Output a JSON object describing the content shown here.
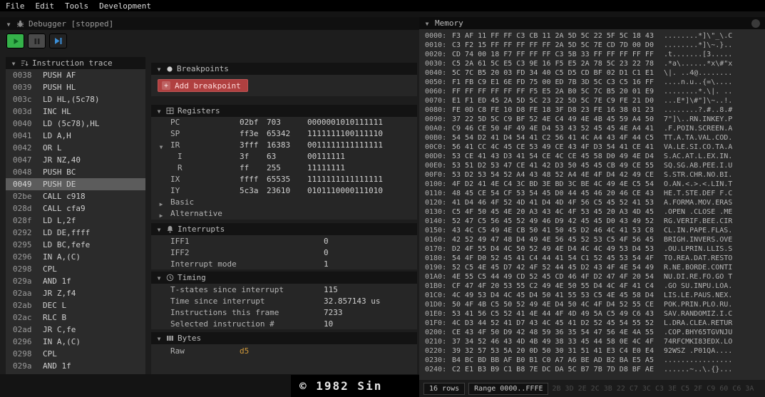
{
  "menu": {
    "items": [
      "File",
      "Edit",
      "Tools",
      "Development"
    ]
  },
  "colors": {
    "accent_red": "#b04040",
    "value_orange": "#d29a3a",
    "play_green": "#35b24a",
    "step_blue": "#3b8fd8",
    "selected_row": "#5c5c5c"
  },
  "debugger": {
    "title": "Debugger [stopped]",
    "toolbar_icons": [
      "play-icon",
      "pause-icon",
      "step-icon"
    ]
  },
  "trace": {
    "title": "Instruction trace",
    "selected_index": 9,
    "rows": [
      {
        "addr": "0038",
        "instr": "PUSH AF"
      },
      {
        "addr": "0039",
        "instr": "PUSH HL"
      },
      {
        "addr": "003c",
        "instr": "LD HL,(5c78)"
      },
      {
        "addr": "003d",
        "instr": "INC HL"
      },
      {
        "addr": "0040",
        "instr": "LD (5c78),HL"
      },
      {
        "addr": "0041",
        "instr": "LD A,H"
      },
      {
        "addr": "0042",
        "instr": "OR L"
      },
      {
        "addr": "0047",
        "instr": "JR NZ,40"
      },
      {
        "addr": "0048",
        "instr": "PUSH BC"
      },
      {
        "addr": "0049",
        "instr": "PUSH DE"
      },
      {
        "addr": "02be",
        "instr": "CALL c918"
      },
      {
        "addr": "028d",
        "instr": "CALL cfa9"
      },
      {
        "addr": "028f",
        "instr": "LD L,2f"
      },
      {
        "addr": "0292",
        "instr": "LD DE,ffff"
      },
      {
        "addr": "0295",
        "instr": "LD BC,fefe"
      },
      {
        "addr": "0296",
        "instr": "IN A,(C)"
      },
      {
        "addr": "0298",
        "instr": "CPL"
      },
      {
        "addr": "029a",
        "instr": "AND 1f"
      },
      {
        "addr": "02aa",
        "instr": "JR Z,f4"
      },
      {
        "addr": "02ab",
        "instr": "DEC L"
      },
      {
        "addr": "02ac",
        "instr": "RLC B"
      },
      {
        "addr": "02ad",
        "instr": "JR C,fe"
      },
      {
        "addr": "0296",
        "instr": "IN A,(C)"
      },
      {
        "addr": "0298",
        "instr": "CPL"
      },
      {
        "addr": "029a",
        "instr": "AND 1f"
      }
    ]
  },
  "breakpoints": {
    "title": "Breakpoints",
    "add_label": "Add breakpoint"
  },
  "registers": {
    "title": "Registers",
    "rows": [
      {
        "name": "PC",
        "hex": "02bf",
        "dec": "703",
        "bin": "0000001010111111",
        "indent": false,
        "expandable": false
      },
      {
        "name": "SP",
        "hex": "ff3e",
        "dec": "65342",
        "bin": "1111111100111110",
        "indent": false,
        "expandable": false
      },
      {
        "name": "IR",
        "hex": "3fff",
        "dec": "16383",
        "bin": "0011111111111111",
        "indent": false,
        "expandable": true
      },
      {
        "name": "I",
        "hex": "3f",
        "dec": "63",
        "bin": "00111111",
        "indent": true,
        "expandable": false
      },
      {
        "name": "R",
        "hex": "ff",
        "dec": "255",
        "bin": "11111111",
        "indent": true,
        "expandable": false
      },
      {
        "name": "IX",
        "hex": "ffff",
        "dec": "65535",
        "bin": "1111111111111111",
        "indent": false,
        "expandable": false
      },
      {
        "name": "IY",
        "hex": "5c3a",
        "dec": "23610",
        "bin": "0101110000111010",
        "indent": false,
        "expandable": false
      }
    ],
    "groups": [
      {
        "label": "Basic"
      },
      {
        "label": "Alternative"
      }
    ]
  },
  "interrupts": {
    "title": "Interrupts",
    "rows": [
      {
        "label": "IFF1",
        "value": "0"
      },
      {
        "label": "IFF2",
        "value": "0"
      },
      {
        "label": "Interrupt mode",
        "value": "1"
      }
    ]
  },
  "timing": {
    "title": "Timing",
    "rows": [
      {
        "label": "T-states since interrupt",
        "value": "115"
      },
      {
        "label": "Time since interrupt",
        "value": "32.857143 us"
      },
      {
        "label": "Instructions this frame",
        "value": "7233"
      },
      {
        "label": "Selected instruction #",
        "value": "10"
      }
    ]
  },
  "bytes": {
    "title": "Bytes",
    "rows": [
      {
        "label": "Raw",
        "value": "d5"
      }
    ]
  },
  "memory": {
    "title": "Memory",
    "footer": {
      "rows_label": "16 rows",
      "range_label": "Range 0000..FFFE",
      "ghost_hex": "2B 3D 2E 2C 3B 22 C7 3C C3 3E C5 2F C9 60 C6 3A"
    },
    "rows": [
      {
        "addr": "0000",
        "hex": "F3 AF 11 FF FF C3 CB 11 2A 5D 5C 22 5F 5C 18 43",
        "ascii": "........*]\\\"_\\.C"
      },
      {
        "addr": "0010",
        "hex": "C3 F2 15 FF FF FF FF FF 2A 5D 5C 7E CD 7D 00 D0",
        "ascii": "........*]\\~.}.."
      },
      {
        "addr": "0020",
        "hex": "CD 74 00 18 F7 FF FF FF C3 5B 33 FF FF FF FF FF",
        "ascii": ".t.......[3....."
      },
      {
        "addr": "0030",
        "hex": "C5 2A 61 5C E5 C3 9E 16 F5 E5 2A 78 5C 23 22 78",
        "ascii": ".*a\\......*x\\#\"x"
      },
      {
        "addr": "0040",
        "hex": "5C 7C B5 20 03 FD 34 40 C5 D5 CD BF 02 D1 C1 E1",
        "ascii": "\\|. ..4@........"
      },
      {
        "addr": "0050",
        "hex": "F1 FB C9 E1 6E FD 75 00 ED 7B 3D 5C C3 C5 16 FF",
        "ascii": "....n.u..{=\\...."
      },
      {
        "addr": "0060",
        "hex": "FF FF FF FF FF FF F5 E5 2A B0 5C 7C B5 20 01 E9",
        "ascii": "........*.\\|. .."
      },
      {
        "addr": "0070",
        "hex": "E1 F1 ED 45 2A 5D 5C 23 22 5D 5C 7E C9 FE 21 D0",
        "ascii": "...E*]\\#\"]\\~..!."
      },
      {
        "addr": "0080",
        "hex": "FE 0D C8 FE 10 D8 FE 18 3F D8 23 FE 16 38 01 23",
        "ascii": "........?.#..8.#"
      },
      {
        "addr": "0090",
        "hex": "37 22 5D 5C C9 BF 52 4E C4 49 4E 4B 45 59 A4 50",
        "ascii": "7\"]\\..RN.INKEY.P"
      },
      {
        "addr": "00A0",
        "hex": "C9 46 CE 50 4F 49 4E D4 53 43 52 45 45 4E A4 41",
        "ascii": ".F.POIN.SCREEN.A"
      },
      {
        "addr": "00B0",
        "hex": "54 54 D2 41 D4 54 41 C2 56 41 4C A4 43 4F 44 C5",
        "ascii": "TT.A.TA.VAL.COD."
      },
      {
        "addr": "00C0",
        "hex": "56 41 CC 4C 45 CE 53 49 CE 43 4F D3 54 41 CE 41",
        "ascii": "VA.LE.SI.CO.TA.A"
      },
      {
        "addr": "00D0",
        "hex": "53 CE 41 43 D3 41 54 CE 4C CE 45 58 D0 49 4E D4",
        "ascii": "S.AC.AT.L.EX.IN."
      },
      {
        "addr": "00E0",
        "hex": "53 51 D2 53 47 CE 41 42 D3 50 45 45 CB 49 CE 55",
        "ascii": "SQ.SG.AB.PEE.I.U"
      },
      {
        "addr": "00F0",
        "hex": "53 D2 53 54 52 A4 43 48 52 A4 4E 4F D4 42 49 CE",
        "ascii": "S.STR.CHR.NO.BI."
      },
      {
        "addr": "0100",
        "hex": "4F D2 41 4E C4 3C BD 3E BD 3C BE 4C 49 4E C5 54",
        "ascii": "O.AN.<.>.<.LIN.T"
      },
      {
        "addr": "0110",
        "hex": "48 45 CE 54 CF 53 54 45 D0 44 45 46 20 46 CE 43",
        "ascii": "HE.T.STE.DEF F.C"
      },
      {
        "addr": "0120",
        "hex": "41 D4 46 4F 52 4D 41 D4 4D 4F 56 C5 45 52 41 53",
        "ascii": "A.FORMA.MOV.ERAS"
      },
      {
        "addr": "0130",
        "hex": "C5 4F 50 45 4E 20 A3 43 4C 4F 53 45 20 A3 4D 45",
        "ascii": ".OPEN .CLOSE .ME"
      },
      {
        "addr": "0140",
        "hex": "52 47 C5 56 45 52 49 46 D9 42 45 45 D0 43 49 52",
        "ascii": "RG.VERIF.BEE.CIR"
      },
      {
        "addr": "0150",
        "hex": "43 4C C5 49 4E CB 50 41 50 45 D2 46 4C 41 53 C8",
        "ascii": "CL.IN.PAPE.FLAS."
      },
      {
        "addr": "0160",
        "hex": "42 52 49 47 48 D4 49 4E 56 45 52 53 C5 4F 56 45",
        "ascii": "BRIGH.INVERS.OVE"
      },
      {
        "addr": "0170",
        "hex": "D2 4F 55 D4 4C 50 52 49 4E D4 4C 4C 49 53 D4 53",
        "ascii": ".OU.LPRIN.LLIS.S"
      },
      {
        "addr": "0180",
        "hex": "54 4F D0 52 45 41 C4 44 41 54 C1 52 45 53 54 4F",
        "ascii": "TO.REA.DAT.RESTO"
      },
      {
        "addr": "0190",
        "hex": "52 C5 4E 45 D7 42 4F 52 44 45 D2 43 4F 4E 54 49",
        "ascii": "R.NE.BORDE.CONTI"
      },
      {
        "addr": "01A0",
        "hex": "4E 55 C5 44 49 CD 52 45 CD 46 4F D2 47 4F 20 54",
        "ascii": "NU.DI.RE.FO.GO T"
      },
      {
        "addr": "01B0",
        "hex": "CF 47 4F 20 53 55 C2 49 4E 50 55 D4 4C 4F 41 C4",
        "ascii": ".GO SU.INPU.LOA."
      },
      {
        "addr": "01C0",
        "hex": "4C 49 53 D4 4C 45 D4 50 41 55 53 C5 4E 45 58 D4",
        "ascii": "LIS.LE.PAUS.NEX."
      },
      {
        "addr": "01D0",
        "hex": "50 4F 4B C5 50 52 49 4E D4 50 4C 4F D4 52 55 CE",
        "ascii": "POK.PRIN.PLO.RU."
      },
      {
        "addr": "01E0",
        "hex": "53 41 56 C5 52 41 4E 44 4F 4D 49 5A C5 49 C6 43",
        "ascii": "SAV.RANDOMIZ.I.C"
      },
      {
        "addr": "01F0",
        "hex": "4C D3 44 52 41 D7 43 4C 45 41 D2 52 45 54 55 52",
        "ascii": "L.DRA.CLEA.RETUR"
      },
      {
        "addr": "0200",
        "hex": "CE 43 4F 50 D9 42 48 59 36 35 54 47 56 4E 4A 55",
        "ascii": ".COP.BHY65TGVNJU"
      },
      {
        "addr": "0210",
        "hex": "37 34 52 46 43 4D 4B 49 38 33 45 44 58 0E 4C 4F",
        "ascii": "74RFCMKI83EDX.LO"
      },
      {
        "addr": "0220",
        "hex": "39 32 57 53 5A 20 0D 50 30 31 51 41 E3 C4 E0 E4",
        "ascii": "92WSZ .P01QA...."
      },
      {
        "addr": "0230",
        "hex": "B4 BC BD BB AF B0 B1 C0 A7 A6 BE AD B2 BA E5 A5",
        "ascii": "................"
      },
      {
        "addr": "0240",
        "hex": "C2 E1 B3 B9 C1 B8 7E DC DA 5C B7 7B 7D D8 BF AE",
        "ascii": "......~..\\.{}..."
      }
    ]
  },
  "screen": {
    "text": "© 1982 Sin"
  }
}
